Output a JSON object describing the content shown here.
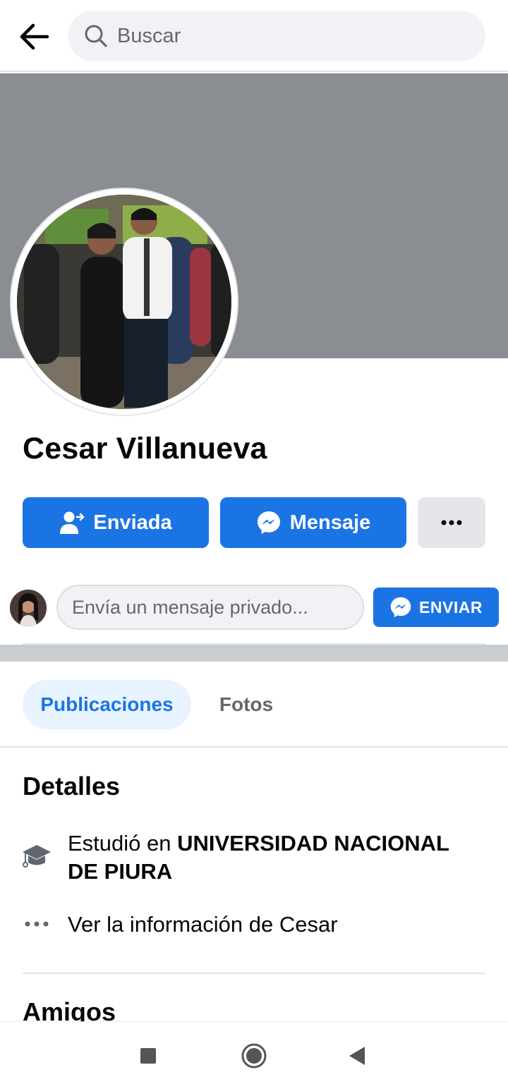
{
  "search": {
    "placeholder": "Buscar"
  },
  "profile": {
    "name": "Cesar Villanueva",
    "buttons": {
      "friend_request": "Enviada",
      "message": "Mensaje",
      "more": "···"
    }
  },
  "private_message": {
    "placeholder": "Envía un mensaje privado...",
    "send_label": "ENVIAR"
  },
  "tabs": [
    {
      "label": "Publicaciones",
      "active": true
    },
    {
      "label": "Fotos",
      "active": false
    }
  ],
  "details": {
    "title": "Detalles",
    "education_prefix": "Estudió en ",
    "education_school": "UNIVERSIDAD NACIONAL DE PIURA",
    "see_info": "Ver la información de Cesar"
  },
  "friends": {
    "title": "Amigos"
  },
  "colors": {
    "accent": "#1b74e4",
    "cover": "#8a8d91",
    "tab_active_bg": "#e7f3ff"
  },
  "icons": [
    "back-arrow-icon",
    "search-icon",
    "person-add-icon",
    "messenger-icon",
    "more-dots-icon",
    "graduation-cap-icon",
    "nav-recents-icon",
    "nav-home-icon",
    "nav-back-icon"
  ]
}
